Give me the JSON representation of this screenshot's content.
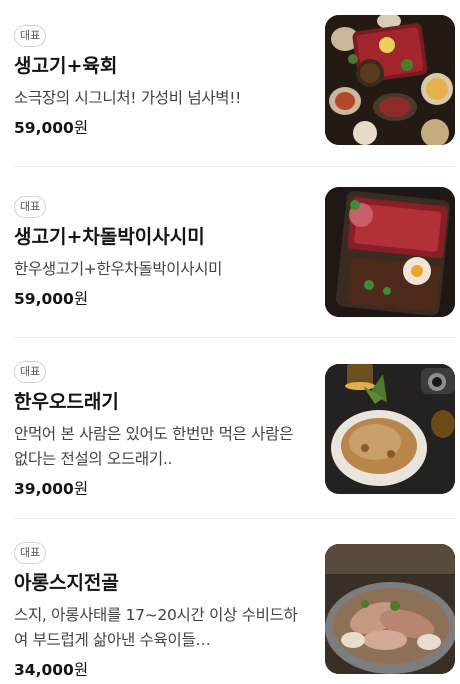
{
  "menu": {
    "items": [
      {
        "badge": "대표",
        "name": "생고기+육회",
        "description": "소극장의 시그니처! 가성비 넘사벽!!",
        "price": "59,000",
        "currency": "원"
      },
      {
        "badge": "대표",
        "name": "생고기+차돌박이사시미",
        "description": "한우생고기+한우차돌박이사시미",
        "price": "59,000",
        "currency": "원"
      },
      {
        "badge": "대표",
        "name": "한우오드래기",
        "description": "안먹어 본 사람은 있어도 한번만 먹은 사람은 없다는 전설의 오드래기..",
        "price": "39,000",
        "currency": "원"
      },
      {
        "badge": "대표",
        "name": "아롱스지전골",
        "description": "스지, 아롱사태를 17~20시간 이상 수비드하여 부드럽게 삶아낸 수육이들…",
        "price": "34,000",
        "currency": "원"
      }
    ]
  }
}
